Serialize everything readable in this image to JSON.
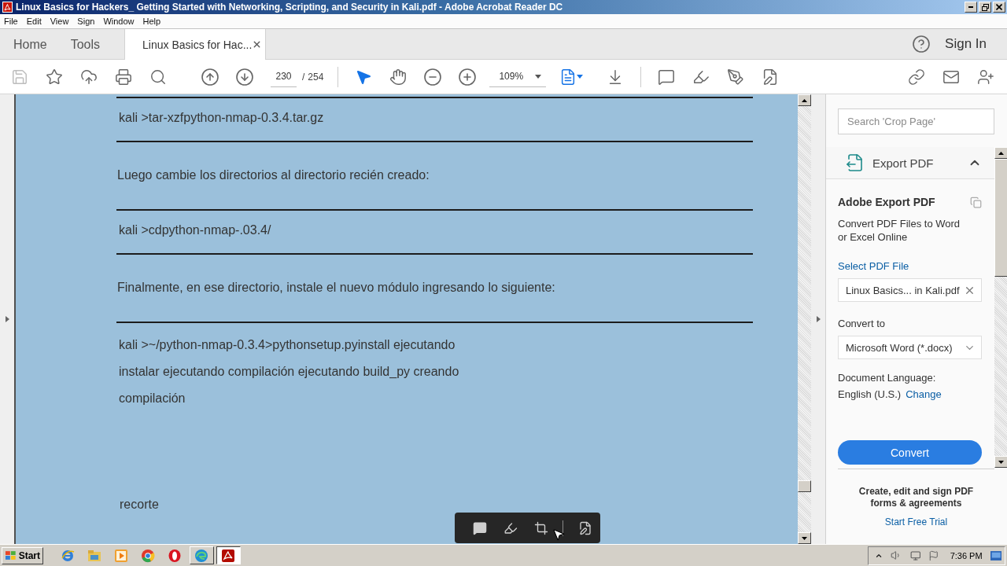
{
  "window": {
    "title": "Linux Basics for Hackers_ Getting Started with Networking, Scripting, and Security in Kali.pdf - Adobe Acrobat Reader DC"
  },
  "menu_bar": [
    "File",
    "Edit",
    "View",
    "Sign",
    "Window",
    "Help"
  ],
  "tabs": [
    {
      "label": "Home",
      "kind": "nav",
      "selected": false
    },
    {
      "label": "Tools",
      "kind": "nav",
      "selected": false
    },
    {
      "label": "Linux Basics for Hac...",
      "kind": "document",
      "selected": true
    }
  ],
  "account": {
    "sign_in": "Sign In"
  },
  "toolbar": {
    "save": {
      "disabled": true
    },
    "page_current": "230",
    "page_separator": "/",
    "page_total": "254",
    "pointer_tools": [
      {
        "selected": true
      },
      {
        "selected": false
      }
    ],
    "zoom": "109%"
  },
  "document": {
    "blocks": [
      {
        "kind": "rule"
      },
      {
        "kind": "code",
        "lines": [
          "kali >tar-xzfpython-nmap-0.3.4.tar.gz"
        ]
      },
      {
        "kind": "rule"
      },
      {
        "kind": "para",
        "text": "Luego cambie los directorios al directorio recién creado:"
      },
      {
        "kind": "rule"
      },
      {
        "kind": "code",
        "lines": [
          "kali >cdpython-nmap-.03.4/"
        ]
      },
      {
        "kind": "rule"
      },
      {
        "kind": "para",
        "text": "Finalmente, en ese directorio, instale el nuevo módulo ingresando lo siguiente:"
      },
      {
        "kind": "rule"
      },
      {
        "kind": "code",
        "lines": [
          "kali >~/python-nmap-0.3.4>pythonsetup.pyinstall ejecutando",
          "instalar ejecutando compilación ejecutando build_py creando",
          "compilación"
        ]
      },
      {
        "kind": "caption",
        "text": "recorte"
      }
    ]
  },
  "right_panel": {
    "search": {
      "placeholder": "Search 'Crop Page'"
    },
    "section": {
      "title": "Export PDF",
      "expanded": true,
      "heading": "Adobe Export PDF",
      "description": "Convert PDF Files to Word or Excel Online",
      "select_link": "Select PDF File",
      "file": "Linux Basics... in Kali.pdf",
      "convert_to_label": "Convert to",
      "format": "Microsoft Word (*.docx)",
      "language_label": "Document Language:",
      "language": "English (U.S.)",
      "change_link": "Change",
      "convert_button": "Convert"
    },
    "promo": {
      "text": "Create, edit and sign PDF forms & agreements",
      "link": "Start Free Trial"
    }
  },
  "taskbar": {
    "start": "Start",
    "apps": [
      {
        "kind": "ie",
        "running": false,
        "selected": false
      },
      {
        "kind": "explorer",
        "running": false,
        "selected": false
      },
      {
        "kind": "media",
        "running": false,
        "selected": false
      },
      {
        "kind": "chrome",
        "running": false,
        "selected": false
      },
      {
        "kind": "opera",
        "running": false,
        "selected": false
      },
      {
        "kind": "edge",
        "running": true,
        "selected": false
      },
      {
        "kind": "acrobat",
        "running": true,
        "selected": true
      }
    ],
    "clock": "7:36 PM"
  }
}
